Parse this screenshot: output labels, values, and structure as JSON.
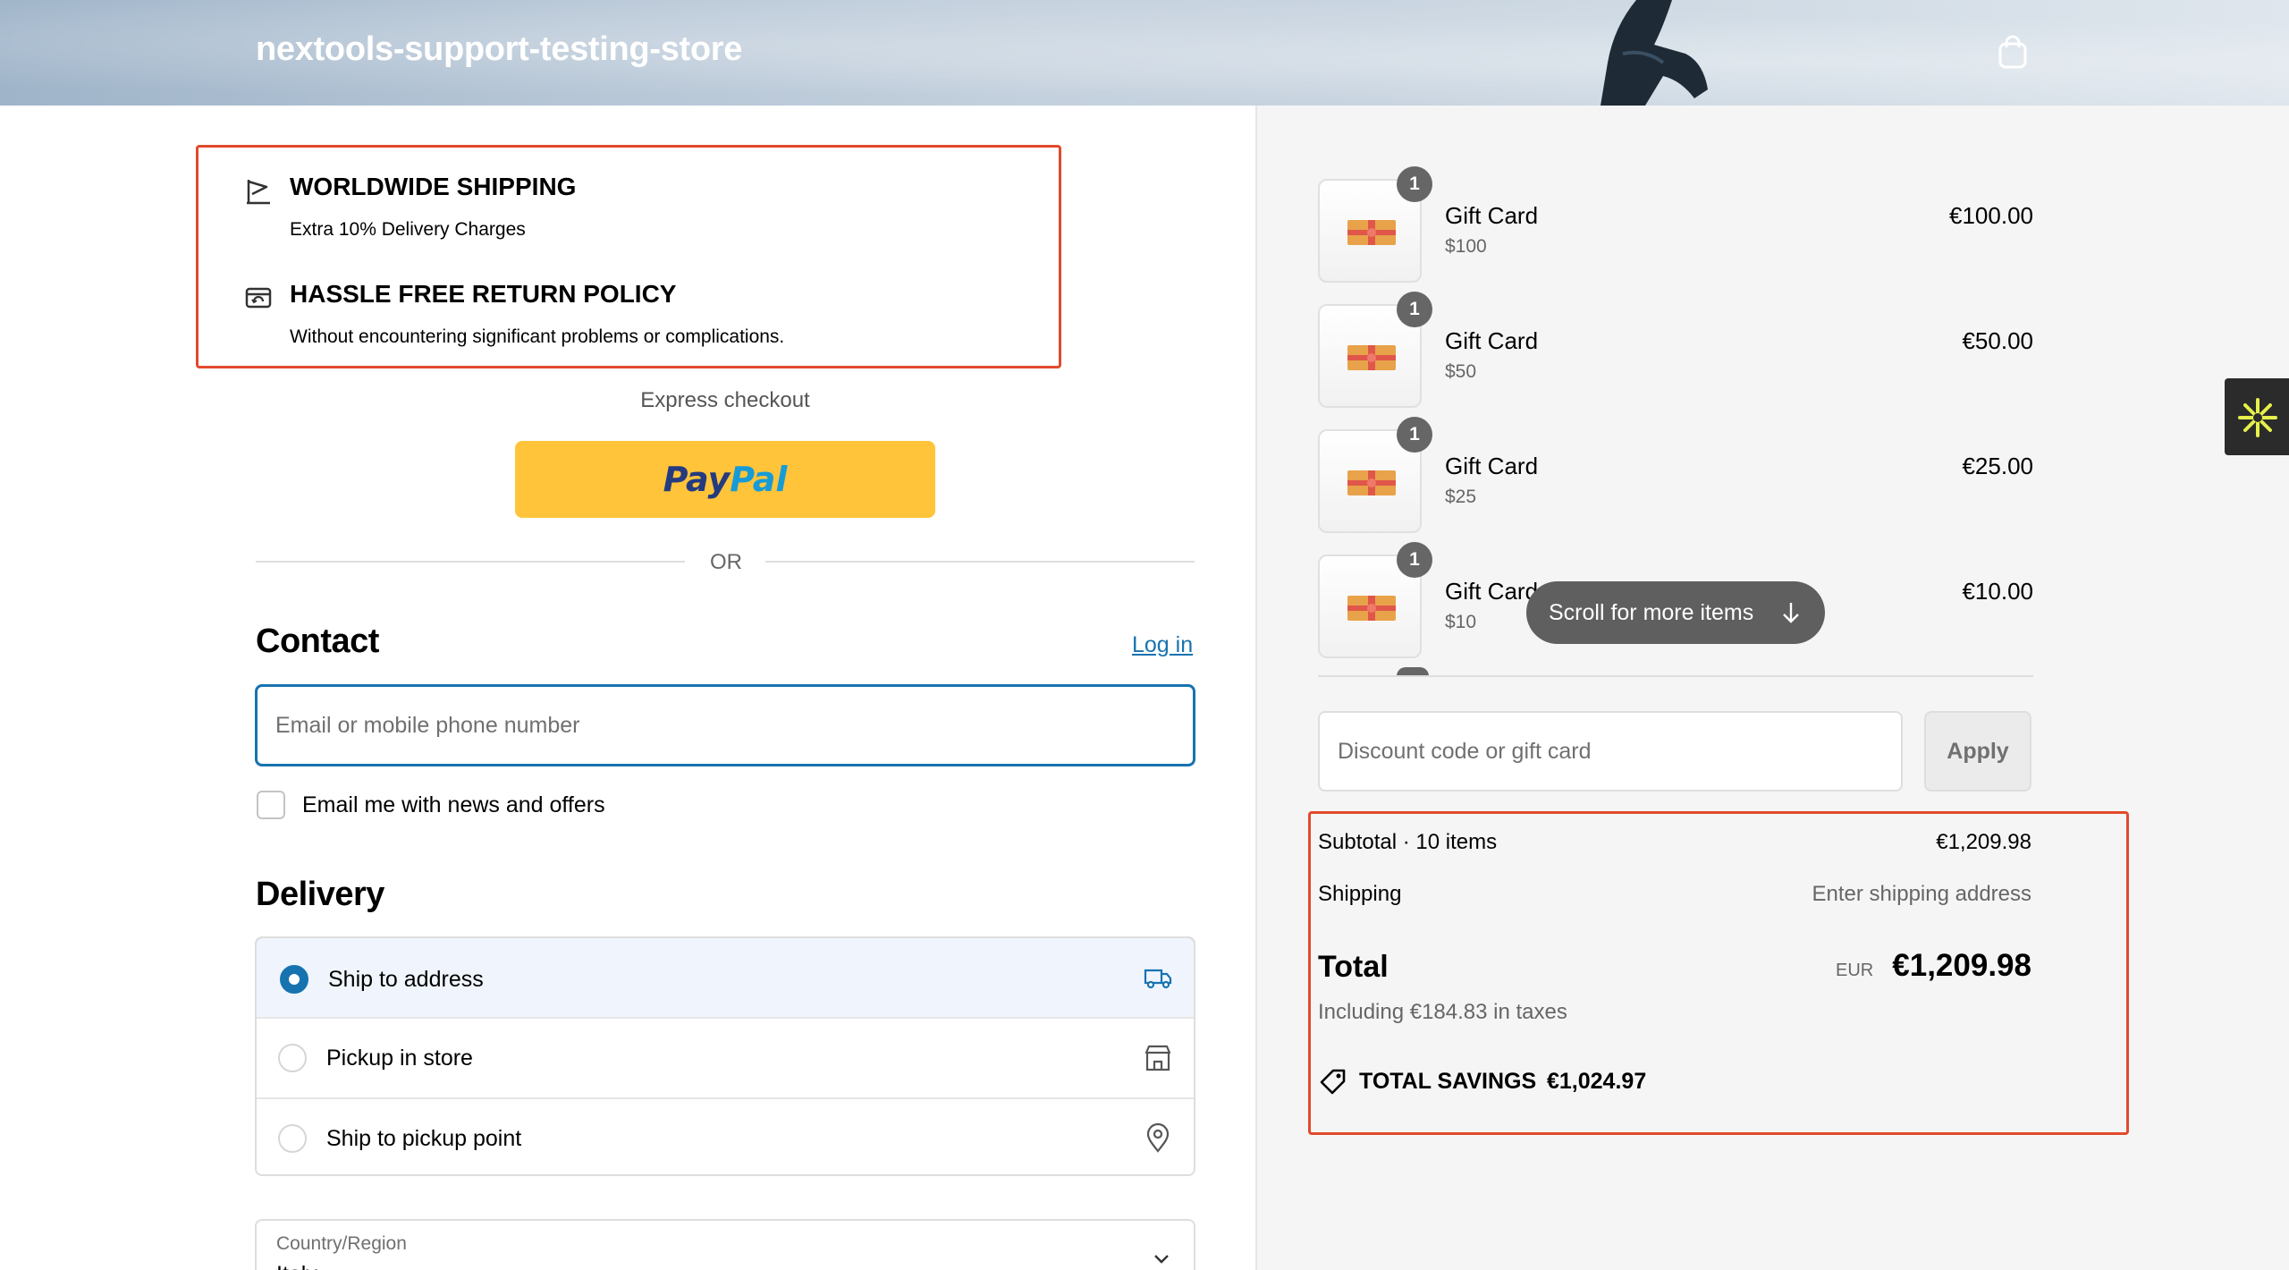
{
  "header": {
    "store_name": "nextools-support-testing-store",
    "cart_icon": "shopping-bag-icon"
  },
  "promo": {
    "items": [
      {
        "icon": "shipping-flag-icon",
        "title": "WORLDWIDE SHIPPING",
        "subtitle": "Extra 10% Delivery Charges"
      },
      {
        "icon": "return-icon",
        "title": "HASSLE FREE RETURN POLICY",
        "subtitle": "Without encountering significant problems or complications."
      }
    ],
    "border_color": "#e24a2c"
  },
  "express": {
    "label": "Express checkout",
    "paypal_part1": "Pay",
    "paypal_part2": "Pal",
    "or_label": "OR"
  },
  "contact": {
    "heading": "Contact",
    "login_link": "Log in",
    "email_placeholder": "Email or mobile phone number",
    "news_checkbox_label": "Email me with news and offers",
    "news_checked": false
  },
  "delivery": {
    "heading": "Delivery",
    "options": [
      {
        "label": "Ship to address",
        "icon": "truck-icon",
        "selected": true
      },
      {
        "label": "Pickup in store",
        "icon": "store-icon",
        "selected": false
      },
      {
        "label": "Ship to pickup point",
        "icon": "location-pin-icon",
        "selected": false
      }
    ],
    "country_label": "Country/Region",
    "country_value": "Italy"
  },
  "cart": {
    "items": [
      {
        "name": "Gift Card",
        "variant": "$100",
        "price": "€100.00",
        "qty": "1"
      },
      {
        "name": "Gift Card",
        "variant": "$50",
        "price": "€50.00",
        "qty": "1"
      },
      {
        "name": "Gift Card",
        "variant": "$25",
        "price": "€25.00",
        "qty": "1"
      },
      {
        "name": "Gift Card",
        "variant": "$10",
        "price": "€10.00",
        "qty": "1"
      }
    ],
    "scroll_hint": "Scroll for more items"
  },
  "discount": {
    "placeholder": "Discount code or gift card",
    "apply_label": "Apply"
  },
  "summary": {
    "subtotal_label": "Subtotal · 10 items",
    "subtotal_value": "€1,209.98",
    "shipping_label": "Shipping",
    "shipping_value": "Enter shipping address",
    "total_label": "Total",
    "currency": "EUR",
    "total_value": "€1,209.98",
    "taxes_note": "Including €184.83 in taxes",
    "savings_label": "TOTAL SAVINGS",
    "savings_value": "€1,024.97"
  },
  "colors": {
    "accent": "#1773b0",
    "annotation": "#e24a2c",
    "paypal": "#ffc439",
    "side_tab_icon": "#e6f04a"
  }
}
